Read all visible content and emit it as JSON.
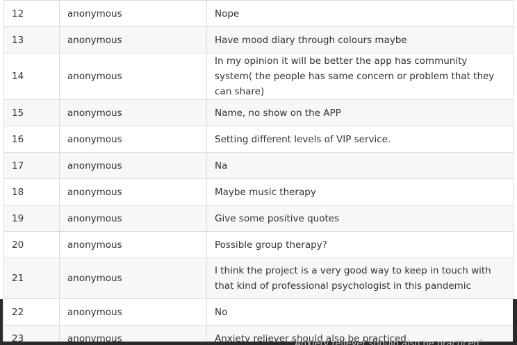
{
  "table": {
    "rows": [
      {
        "num": "12",
        "user": "anonymous",
        "response": "Nope"
      },
      {
        "num": "13",
        "user": "anonymous",
        "response": "Have mood diary through colours maybe"
      },
      {
        "num": "14",
        "user": "anonymous",
        "response": "In my opinion it will be better the app has community system( the people has same concern or problem that they can share)"
      },
      {
        "num": "15",
        "user": "anonymous",
        "response": "Name, no show on the APP"
      },
      {
        "num": "16",
        "user": "anonymous",
        "response": "Setting different levels of VIP service."
      },
      {
        "num": "17",
        "user": "anonymous",
        "response": "Na"
      },
      {
        "num": "18",
        "user": "anonymous",
        "response": "Maybe music therapy"
      },
      {
        "num": "19",
        "user": "anonymous",
        "response": "Give some positive quotes"
      },
      {
        "num": "20",
        "user": "anonymous",
        "response": "Possible group therapy?"
      },
      {
        "num": "21",
        "user": "anonymous",
        "response": "I think the project is a very good way to keep in touch with that kind of professional psychologist in this pandemic"
      },
      {
        "num": "22",
        "user": "anonymous",
        "response": "No"
      },
      {
        "num": "23",
        "user": "anonymous",
        "response": "Anxiety reliever should also be practiced"
      }
    ]
  },
  "caption": "\"Anxiety reliever should also be practiced\""
}
